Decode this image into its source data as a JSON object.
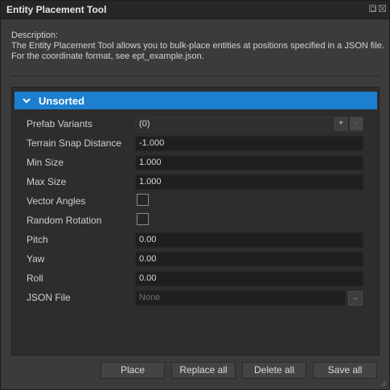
{
  "window": {
    "title": "Entity Placement Tool"
  },
  "description": {
    "heading": "Description:",
    "line1": "The Entity Placement Tool allows you to bulk-place entities at positions specified in a JSON file.",
    "line2": "For the coordinate format, see ept_example.json."
  },
  "section": {
    "label": "Unsorted",
    "expanded": true,
    "icon": "chevron-down-icon"
  },
  "properties": {
    "prefab_variants": {
      "label": "Prefab Variants",
      "value": "(0)",
      "add_label": "+",
      "remove_label": "-"
    },
    "terrain_snap_distance": {
      "label": "Terrain Snap Distance",
      "value": "-1.000"
    },
    "min_size": {
      "label": "Min Size",
      "value": "1.000"
    },
    "max_size": {
      "label": "Max Size",
      "value": "1.000"
    },
    "vector_angles": {
      "label": "Vector Angles",
      "checked": false
    },
    "random_rotation": {
      "label": "Random Rotation",
      "checked": false
    },
    "pitch": {
      "label": "Pitch",
      "value": "0.00"
    },
    "yaw": {
      "label": "Yaw",
      "value": "0.00"
    },
    "roll": {
      "label": "Roll",
      "value": "0.00"
    },
    "json_file": {
      "label": "JSON File",
      "placeholder": "None",
      "browse_label": ".."
    }
  },
  "buttons": {
    "place": "Place",
    "replace_all": "Replace all",
    "delete_all": "Delete all",
    "save_all": "Save all"
  },
  "colors": {
    "accent": "#1c7fd0",
    "window_bg": "#3b3b3b",
    "panel_bg": "#2d2d2d",
    "field_bg": "#1f1f1f"
  }
}
